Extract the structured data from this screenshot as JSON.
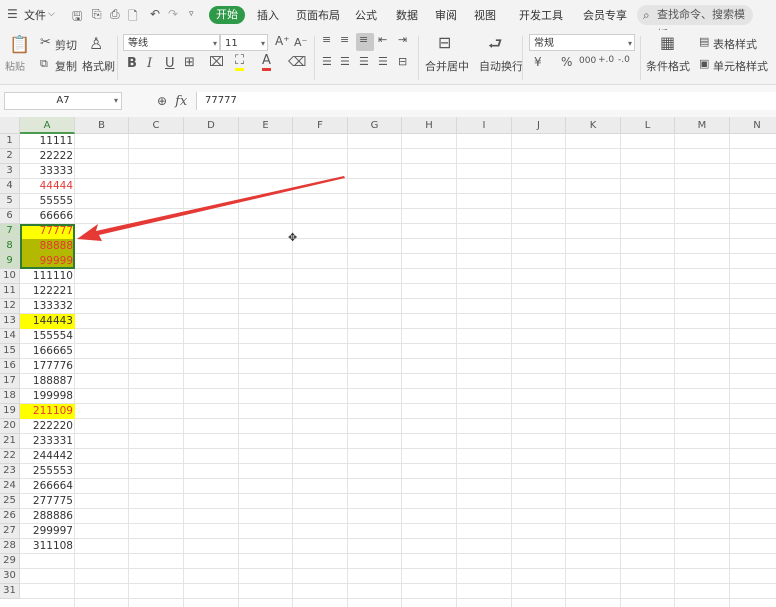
{
  "menubar": {
    "file_label": "文件",
    "tabs": [
      "开始",
      "插入",
      "页面布局",
      "公式",
      "数据",
      "审阅",
      "视图",
      "开发工具",
      "会员专享"
    ],
    "active_tab": "开始",
    "search_placeholder": "查找命令、搜索模板"
  },
  "ribbon": {
    "paste_label": "粘贴",
    "cut_label": "剪切",
    "copy_label": "复制",
    "format_painter_label": "格式刷",
    "font_name": "等线",
    "font_size": "11",
    "merge_label": "合并居中",
    "wrap_label": "自动换行",
    "number_format": "常规",
    "conditional_format_label": "条件格式",
    "table_style_label": "表格样式",
    "cell_style_label": "单元格样式"
  },
  "formula_bar": {
    "name_box": "A7",
    "fx_label": "fx",
    "formula_value": "77777"
  },
  "columns": [
    "A",
    "B",
    "C",
    "D",
    "E",
    "F",
    "G",
    "H",
    "I",
    "J",
    "K",
    "L",
    "M",
    "N"
  ],
  "selected_column": "A",
  "rows": [
    "1",
    "2",
    "3",
    "4",
    "5",
    "6",
    "7",
    "8",
    "9",
    "10",
    "11",
    "12",
    "13",
    "14",
    "15",
    "16",
    "17",
    "18",
    "19",
    "20",
    "21",
    "22",
    "23",
    "24",
    "25",
    "26",
    "27",
    "28",
    "29",
    "30",
    "31"
  ],
  "selected_rows": [
    "7",
    "8",
    "9"
  ],
  "cells": [
    {
      "row": 1,
      "value": "11111",
      "style": "normal"
    },
    {
      "row": 2,
      "value": "22222",
      "style": "normal"
    },
    {
      "row": 3,
      "value": "33333",
      "style": "normal"
    },
    {
      "row": 4,
      "value": "44444",
      "style": "red"
    },
    {
      "row": 5,
      "value": "55555",
      "style": "normal"
    },
    {
      "row": 6,
      "value": "66666",
      "style": "normal"
    },
    {
      "row": 7,
      "value": "77777",
      "style": "red-yellow"
    },
    {
      "row": 8,
      "value": "88888",
      "style": "red-olive"
    },
    {
      "row": 9,
      "value": "99999",
      "style": "red-olive"
    },
    {
      "row": 10,
      "value": "111110",
      "style": "normal"
    },
    {
      "row": 11,
      "value": "122221",
      "style": "normal"
    },
    {
      "row": 12,
      "value": "133332",
      "style": "normal"
    },
    {
      "row": 13,
      "value": "144443",
      "style": "yellow"
    },
    {
      "row": 14,
      "value": "155554",
      "style": "normal"
    },
    {
      "row": 15,
      "value": "166665",
      "style": "normal"
    },
    {
      "row": 16,
      "value": "177776",
      "style": "normal"
    },
    {
      "row": 17,
      "value": "188887",
      "style": "normal"
    },
    {
      "row": 18,
      "value": "199998",
      "style": "normal"
    },
    {
      "row": 19,
      "value": "211109",
      "style": "red-yellow"
    },
    {
      "row": 20,
      "value": "222220",
      "style": "normal"
    },
    {
      "row": 21,
      "value": "233331",
      "style": "normal"
    },
    {
      "row": 22,
      "value": "244442",
      "style": "normal"
    },
    {
      "row": 23,
      "value": "255553",
      "style": "normal"
    },
    {
      "row": 24,
      "value": "266664",
      "style": "normal"
    },
    {
      "row": 25,
      "value": "277775",
      "style": "normal"
    },
    {
      "row": 26,
      "value": "288886",
      "style": "normal"
    },
    {
      "row": 27,
      "value": "299997",
      "style": "normal"
    },
    {
      "row": 28,
      "value": "311108",
      "style": "normal"
    }
  ],
  "colors": {
    "accent_green": "#2e9a47",
    "highlight_yellow": "#ffff00",
    "highlight_olive": "#b3b800",
    "font_red": "#e53935",
    "arrow_red": "#e53935"
  }
}
